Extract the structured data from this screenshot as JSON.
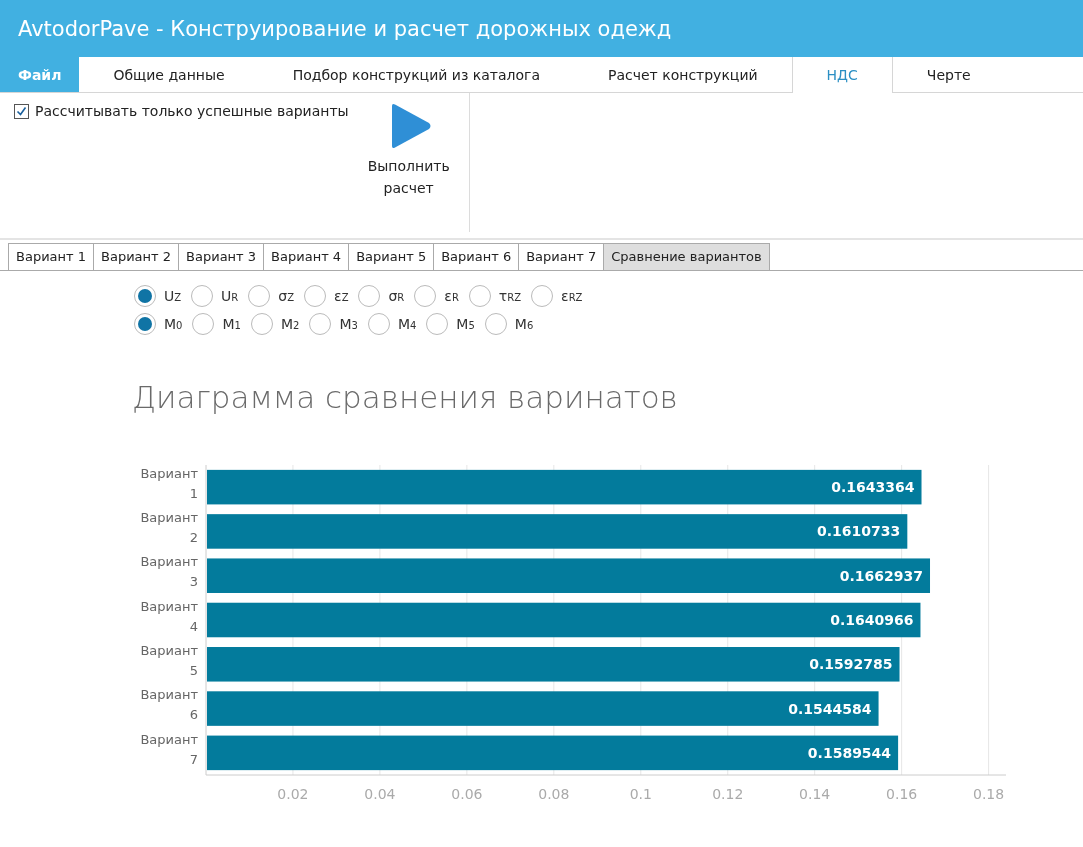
{
  "window": {
    "title": "AvtodorPave - Конструирование и расчет дорожных одежд"
  },
  "menu_tabs": [
    {
      "label": "Файл",
      "kind": "file",
      "selected": false
    },
    {
      "label": "Общие данные",
      "kind": "tab",
      "selected": false
    },
    {
      "label": "Подбор конструкций из каталога",
      "kind": "tab",
      "selected": false
    },
    {
      "label": "Расчет конструкций",
      "kind": "tab",
      "selected": false
    },
    {
      "label": "НДС",
      "kind": "tab",
      "selected": true
    },
    {
      "label": "Черте",
      "kind": "tab",
      "selected": false
    }
  ],
  "ribbon": {
    "checkbox": {
      "label": "Рассчитывать только успешные варианты",
      "checked": true
    },
    "run_button": {
      "label": "Выполнить расчет"
    }
  },
  "variant_tabs": [
    {
      "label": "Вариант 1",
      "selected": false
    },
    {
      "label": "Вариант 2",
      "selected": false
    },
    {
      "label": "Вариант 3",
      "selected": false
    },
    {
      "label": "Вариант 4",
      "selected": false
    },
    {
      "label": "Вариант 5",
      "selected": false
    },
    {
      "label": "Вариант 6",
      "selected": false
    },
    {
      "label": "Вариант 7",
      "selected": false
    },
    {
      "label": "Сравнение вариантов",
      "selected": true
    }
  ],
  "radio_rows": [
    [
      {
        "label": "U$_{Z}$",
        "selected": true
      },
      {
        "label": "U$_{R}$",
        "selected": false
      },
      {
        "label": "σ$_{Z}$",
        "selected": false
      },
      {
        "label": "ε$_{Z}$",
        "selected": false
      },
      {
        "label": "σ$_{R}$",
        "selected": false
      },
      {
        "label": "ε$_{R}$",
        "selected": false
      },
      {
        "label": "τ$_{RZ}$",
        "selected": false
      },
      {
        "label": "ε$_{RZ}$",
        "selected": false
      }
    ],
    [
      {
        "label": "M$_{0}$",
        "selected": true
      },
      {
        "label": "M$_{1}$",
        "selected": false
      },
      {
        "label": "M$_{2}$",
        "selected": false
      },
      {
        "label": "M$_{3}$",
        "selected": false
      },
      {
        "label": "M$_{4}$",
        "selected": false
      },
      {
        "label": "M$_{5}$",
        "selected": false
      },
      {
        "label": "M$_{6}$",
        "selected": false
      }
    ]
  ],
  "chart_data": {
    "type": "bar",
    "orientation": "horizontal",
    "title": "Диаграмма сравнения варинатов",
    "categories": [
      "Вариант 1",
      "Вариант 2",
      "Вариант 3",
      "Вариант 4",
      "Вариант 5",
      "Вариант 6",
      "Вариант 7"
    ],
    "series": [
      {
        "color": "#037b9c",
        "values": [
          0.1643364,
          0.1610733,
          0.1662937,
          0.1640966,
          0.1592785,
          0.1544584,
          0.1589544
        ]
      }
    ],
    "xlim": [
      0,
      0.184
    ],
    "grid": true,
    "xticks": [
      0.02,
      0.04,
      0.06,
      0.08,
      {
        "value": 0.1,
        "label": "0.1"
      },
      0.12,
      0.14,
      0.16,
      0.18
    ],
    "value_labels": [
      "0.1643364",
      "0.1610733",
      "0.1662937",
      "0.1640966",
      "0.1592785",
      "0.1544584",
      "0.1589544"
    ]
  }
}
